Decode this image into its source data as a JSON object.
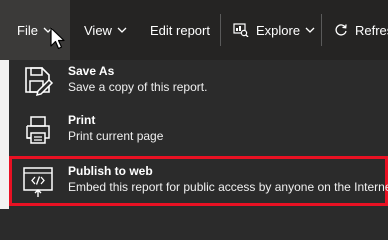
{
  "toolbar": {
    "file_label": "File",
    "view_label": "View",
    "edit_label": "Edit report",
    "explore_label": "Explore",
    "refresh_label": "Refresh"
  },
  "menu": {
    "items": [
      {
        "title": "Save As",
        "description": "Save a copy of this report.",
        "icon": "save-icon"
      },
      {
        "title": "Print",
        "description": "Print current page",
        "icon": "printer-icon"
      },
      {
        "title": "Publish to web",
        "description": "Embed this report for public access by anyone on the Internet",
        "icon": "publish-web-icon",
        "highlighted": true
      }
    ]
  },
  "colors": {
    "toolbar_bg": "#252423",
    "menu_bg": "#2b2b2b",
    "active_tab_bg": "#3b3a39",
    "highlight_border": "#e81123",
    "text": "#ffffff"
  }
}
